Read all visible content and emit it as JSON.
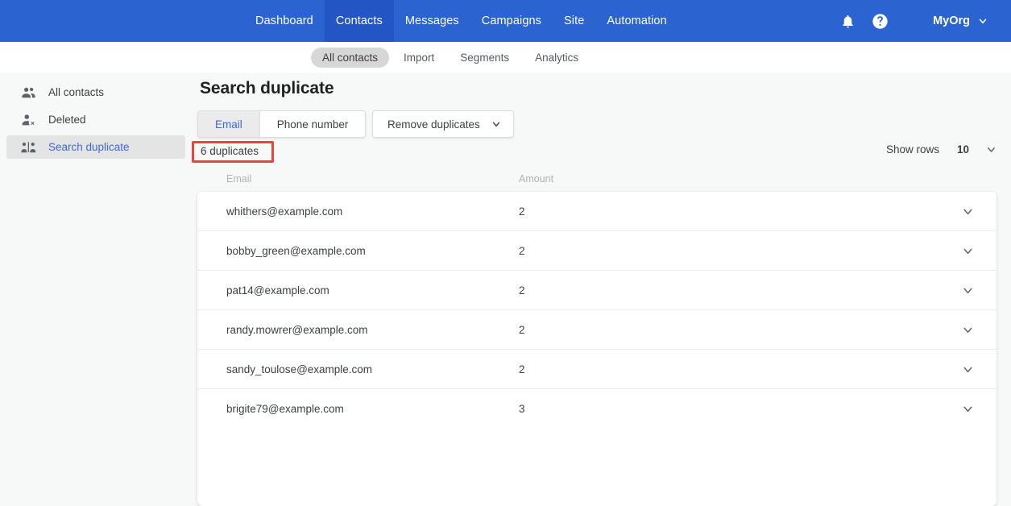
{
  "header": {
    "nav": [
      {
        "label": "Dashboard",
        "active": false
      },
      {
        "label": "Contacts",
        "active": true
      },
      {
        "label": "Messages",
        "active": false
      },
      {
        "label": "Campaigns",
        "active": false
      },
      {
        "label": "Site",
        "active": false
      },
      {
        "label": "Automation",
        "active": false
      }
    ],
    "notifications_icon": "bell-icon",
    "help_icon": "help-circle-icon",
    "org_label": "MyOrg",
    "org_chevron_icon": "chevron-down-icon",
    "background_color": "#2b64d0",
    "active_tab_color": "#2356c4"
  },
  "subnav": {
    "items": [
      {
        "label": "All contacts",
        "active": true
      },
      {
        "label": "Import",
        "active": false
      },
      {
        "label": "Segments",
        "active": false
      },
      {
        "label": "Analytics",
        "active": false
      }
    ]
  },
  "sidebar": {
    "items": [
      {
        "label": "All contacts",
        "icon": "people-icon",
        "active": false
      },
      {
        "label": "Deleted",
        "icon": "person-remove-icon",
        "active": false
      },
      {
        "label": "Search duplicate",
        "icon": "duplicate-people-icon",
        "active": true
      }
    ],
    "active_text_color": "#4268d3",
    "active_background_color": "#e4e4e4"
  },
  "main": {
    "page_title": "Search duplicate",
    "segmented": {
      "options": [
        {
          "label": "Email",
          "active": true
        },
        {
          "label": "Phone number",
          "active": false
        }
      ],
      "active_text_color": "#4268d3"
    },
    "remove_duplicates": {
      "label": "Remove duplicates",
      "chevron_icon": "chevron-down-icon"
    },
    "duplicates_count": {
      "text": "6 duplicates",
      "highlight_color": "#e8463c",
      "highlighted": true
    },
    "show_rows": {
      "label": "Show rows",
      "value": "10",
      "chevron_icon": "chevron-down-icon"
    },
    "table": {
      "columns": [
        "Email",
        "Amount"
      ],
      "rows": [
        {
          "email": "whithers@example.com",
          "amount": "2",
          "chevron_icon": "chevron-down-icon"
        },
        {
          "email": "bobby_green@example.com",
          "amount": "2",
          "chevron_icon": "chevron-down-icon"
        },
        {
          "email": "pat14@example.com",
          "amount": "2",
          "chevron_icon": "chevron-down-icon"
        },
        {
          "email": "randy.mowrer@example.com",
          "amount": "2",
          "chevron_icon": "chevron-down-icon"
        },
        {
          "email": "sandy_toulose@example.com",
          "amount": "2",
          "chevron_icon": "chevron-down-icon"
        },
        {
          "email": "brigite79@example.com",
          "amount": "3",
          "chevron_icon": "chevron-down-icon"
        }
      ]
    }
  }
}
